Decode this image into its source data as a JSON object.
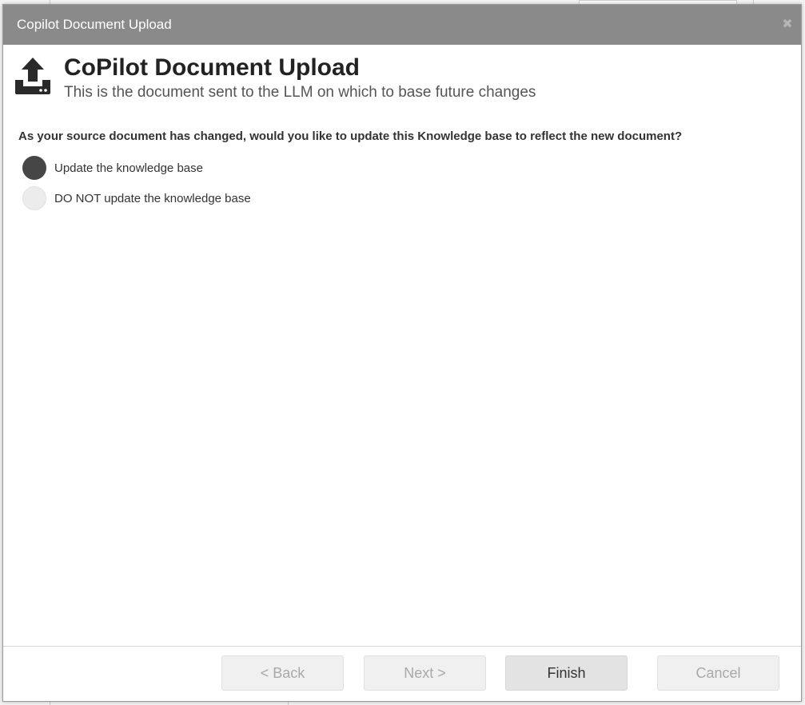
{
  "dialog": {
    "title": "Copilot Document Upload",
    "close_glyph": "✖",
    "header": {
      "title": "CoPilot Document Upload",
      "subtitle": "This is the document sent to the LLM on which to base future changes",
      "icon": "upload-tray-icon"
    },
    "question": "As your source document has changed, would you like to update this Knowledge base to reflect the new document?",
    "options": [
      {
        "label": "Update the knowledge base",
        "selected": true
      },
      {
        "label": "DO NOT update the knowledge base",
        "selected": false
      }
    ],
    "buttons": {
      "back": "< Back",
      "next": "Next >",
      "finish": "Finish",
      "cancel": "Cancel"
    }
  },
  "colors": {
    "titlebar": "#8a8a8a",
    "radio_checked": "#464646",
    "radio_unchecked": "#ececec"
  }
}
